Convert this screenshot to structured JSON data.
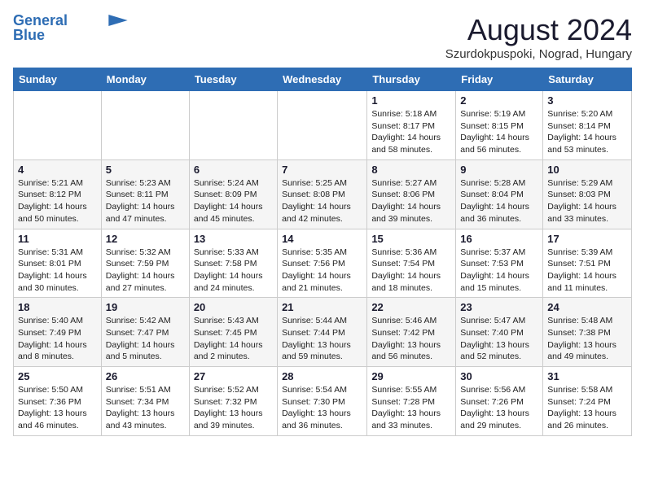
{
  "header": {
    "logo_line1": "General",
    "logo_line2": "Blue",
    "month": "August 2024",
    "location": "Szurdokpuspoki, Nograd, Hungary"
  },
  "weekdays": [
    "Sunday",
    "Monday",
    "Tuesday",
    "Wednesday",
    "Thursday",
    "Friday",
    "Saturday"
  ],
  "weeks": [
    [
      {
        "day": "",
        "info": ""
      },
      {
        "day": "",
        "info": ""
      },
      {
        "day": "",
        "info": ""
      },
      {
        "day": "",
        "info": ""
      },
      {
        "day": "1",
        "info": "Sunrise: 5:18 AM\nSunset: 8:17 PM\nDaylight: 14 hours\nand 58 minutes."
      },
      {
        "day": "2",
        "info": "Sunrise: 5:19 AM\nSunset: 8:15 PM\nDaylight: 14 hours\nand 56 minutes."
      },
      {
        "day": "3",
        "info": "Sunrise: 5:20 AM\nSunset: 8:14 PM\nDaylight: 14 hours\nand 53 minutes."
      }
    ],
    [
      {
        "day": "4",
        "info": "Sunrise: 5:21 AM\nSunset: 8:12 PM\nDaylight: 14 hours\nand 50 minutes."
      },
      {
        "day": "5",
        "info": "Sunrise: 5:23 AM\nSunset: 8:11 PM\nDaylight: 14 hours\nand 47 minutes."
      },
      {
        "day": "6",
        "info": "Sunrise: 5:24 AM\nSunset: 8:09 PM\nDaylight: 14 hours\nand 45 minutes."
      },
      {
        "day": "7",
        "info": "Sunrise: 5:25 AM\nSunset: 8:08 PM\nDaylight: 14 hours\nand 42 minutes."
      },
      {
        "day": "8",
        "info": "Sunrise: 5:27 AM\nSunset: 8:06 PM\nDaylight: 14 hours\nand 39 minutes."
      },
      {
        "day": "9",
        "info": "Sunrise: 5:28 AM\nSunset: 8:04 PM\nDaylight: 14 hours\nand 36 minutes."
      },
      {
        "day": "10",
        "info": "Sunrise: 5:29 AM\nSunset: 8:03 PM\nDaylight: 14 hours\nand 33 minutes."
      }
    ],
    [
      {
        "day": "11",
        "info": "Sunrise: 5:31 AM\nSunset: 8:01 PM\nDaylight: 14 hours\nand 30 minutes."
      },
      {
        "day": "12",
        "info": "Sunrise: 5:32 AM\nSunset: 7:59 PM\nDaylight: 14 hours\nand 27 minutes."
      },
      {
        "day": "13",
        "info": "Sunrise: 5:33 AM\nSunset: 7:58 PM\nDaylight: 14 hours\nand 24 minutes."
      },
      {
        "day": "14",
        "info": "Sunrise: 5:35 AM\nSunset: 7:56 PM\nDaylight: 14 hours\nand 21 minutes."
      },
      {
        "day": "15",
        "info": "Sunrise: 5:36 AM\nSunset: 7:54 PM\nDaylight: 14 hours\nand 18 minutes."
      },
      {
        "day": "16",
        "info": "Sunrise: 5:37 AM\nSunset: 7:53 PM\nDaylight: 14 hours\nand 15 minutes."
      },
      {
        "day": "17",
        "info": "Sunrise: 5:39 AM\nSunset: 7:51 PM\nDaylight: 14 hours\nand 11 minutes."
      }
    ],
    [
      {
        "day": "18",
        "info": "Sunrise: 5:40 AM\nSunset: 7:49 PM\nDaylight: 14 hours\nand 8 minutes."
      },
      {
        "day": "19",
        "info": "Sunrise: 5:42 AM\nSunset: 7:47 PM\nDaylight: 14 hours\nand 5 minutes."
      },
      {
        "day": "20",
        "info": "Sunrise: 5:43 AM\nSunset: 7:45 PM\nDaylight: 14 hours\nand 2 minutes."
      },
      {
        "day": "21",
        "info": "Sunrise: 5:44 AM\nSunset: 7:44 PM\nDaylight: 13 hours\nand 59 minutes."
      },
      {
        "day": "22",
        "info": "Sunrise: 5:46 AM\nSunset: 7:42 PM\nDaylight: 13 hours\nand 56 minutes."
      },
      {
        "day": "23",
        "info": "Sunrise: 5:47 AM\nSunset: 7:40 PM\nDaylight: 13 hours\nand 52 minutes."
      },
      {
        "day": "24",
        "info": "Sunrise: 5:48 AM\nSunset: 7:38 PM\nDaylight: 13 hours\nand 49 minutes."
      }
    ],
    [
      {
        "day": "25",
        "info": "Sunrise: 5:50 AM\nSunset: 7:36 PM\nDaylight: 13 hours\nand 46 minutes."
      },
      {
        "day": "26",
        "info": "Sunrise: 5:51 AM\nSunset: 7:34 PM\nDaylight: 13 hours\nand 43 minutes."
      },
      {
        "day": "27",
        "info": "Sunrise: 5:52 AM\nSunset: 7:32 PM\nDaylight: 13 hours\nand 39 minutes."
      },
      {
        "day": "28",
        "info": "Sunrise: 5:54 AM\nSunset: 7:30 PM\nDaylight: 13 hours\nand 36 minutes."
      },
      {
        "day": "29",
        "info": "Sunrise: 5:55 AM\nSunset: 7:28 PM\nDaylight: 13 hours\nand 33 minutes."
      },
      {
        "day": "30",
        "info": "Sunrise: 5:56 AM\nSunset: 7:26 PM\nDaylight: 13 hours\nand 29 minutes."
      },
      {
        "day": "31",
        "info": "Sunrise: 5:58 AM\nSunset: 7:24 PM\nDaylight: 13 hours\nand 26 minutes."
      }
    ]
  ]
}
